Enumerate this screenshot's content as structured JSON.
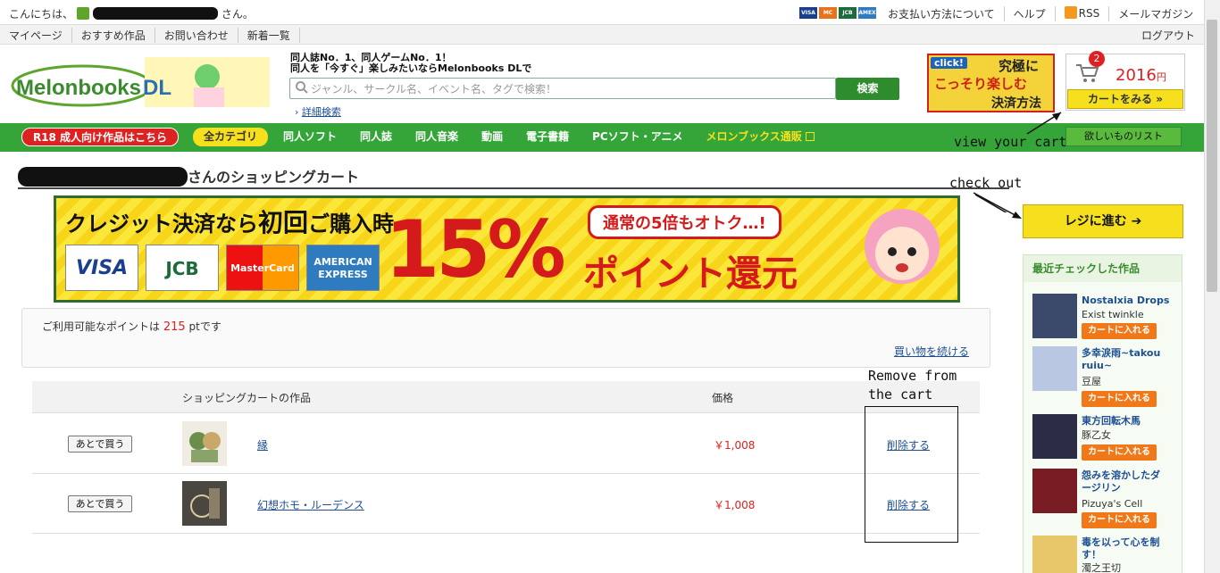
{
  "topbar": {
    "greeting_prefix": "こんにちは、",
    "greeting_suffix": "さん。",
    "card_labels": [
      "VISA",
      "MC",
      "JCB",
      "AMEX"
    ],
    "links": [
      "お支払い方法について",
      "ヘルプ",
      "RSS",
      "メールマガジン"
    ]
  },
  "nav2": {
    "links": [
      "マイページ",
      "おすすめ作品",
      "お問い合わせ",
      "新着一覧"
    ],
    "logout": "ログアウト"
  },
  "header": {
    "logo_text": "Melonbooks",
    "logo_dl": "DL",
    "tagline_line1": "同人誌No．1、同人ゲームNo．1！",
    "tagline_line2": "同人を「今すぐ」楽しみたいならMelonbooks DLで",
    "search_placeholder": "ジャンル、サークル名、イベント名、タグで検索！",
    "search_button": "検索",
    "advanced_search": "詳細検索",
    "promo_click": "click!",
    "promo_line1": "究極に",
    "promo_line2": "こっそり楽しむ",
    "promo_line3": "決済方法",
    "cart_count": "2",
    "cart_amount": "2016",
    "cart_currency": "円",
    "cart_button": "カートをみる »"
  },
  "green_nav": {
    "r18": "R18 成人向け作品はこちら",
    "items": [
      "全カテゴリ",
      "同人ソフト",
      "同人誌",
      "同人音楽",
      "動画",
      "電子書籍",
      "PCソフト・アニメ",
      "メロンブックス通販"
    ],
    "wishlist": "欲しいものリスト"
  },
  "page": {
    "title_suffix": "さんのショッピングカート"
  },
  "banner": {
    "line1_a": "クレジット決済なら",
    "line1_b": "初回",
    "line1_c": "ご購入時",
    "bubble": "通常の5倍もオトク…!",
    "big": "15%",
    "sub": "ポイント還元",
    "cards": [
      "VISA",
      "JCB",
      "MasterCard",
      "AMERICAN EXPRESS"
    ]
  },
  "points": {
    "prefix": "ご利用可能なポイントは",
    "value": "215",
    "suffix": "ptです",
    "continue": "買い物を続ける"
  },
  "cart": {
    "col_title": "ショッピングカートの作品",
    "col_price": "価格",
    "later_label": "あとで買う",
    "delete_label": "削除する",
    "items": [
      {
        "title": "縁",
        "price": "￥1,008"
      },
      {
        "title": "幻想ホモ・ルーデンス",
        "price": "￥1,008"
      }
    ]
  },
  "sidebar": {
    "checkout": "レジに進む",
    "recent_title": "最近チェックした作品",
    "add_to_cart": "カートに入れる",
    "recent": [
      {
        "title": "Nostalxia Drops",
        "circle": "Exist twinkle",
        "bg": "#3b4a6b"
      },
      {
        "title_line1": "多幸涙雨~takou",
        "title_line2": "ruiu~",
        "circle": "豆屋",
        "bg": "#b9c7e3"
      },
      {
        "title": "東方回転木馬",
        "circle": "豚乙女",
        "bg": "#2a2d44"
      },
      {
        "title_line1": "怨みを溶かしたダ",
        "title_line2": "ージリン",
        "circle": "Pizuya's Cell",
        "bg": "#7a1c24"
      },
      {
        "title_line1": "毒を以って心を制",
        "title_line2": "す！",
        "circle": "濁之王切",
        "bg": "#e8c66a"
      }
    ]
  },
  "annotations": {
    "view_cart": "view your cart",
    "check_out": "check out",
    "remove_line1": "Remove from",
    "remove_line2": "the cart"
  },
  "colors": {
    "brand_green": "#35a53a",
    "accent_yellow": "#f6e01e",
    "price_red": "#e02020",
    "link_blue": "#1d4f91"
  }
}
